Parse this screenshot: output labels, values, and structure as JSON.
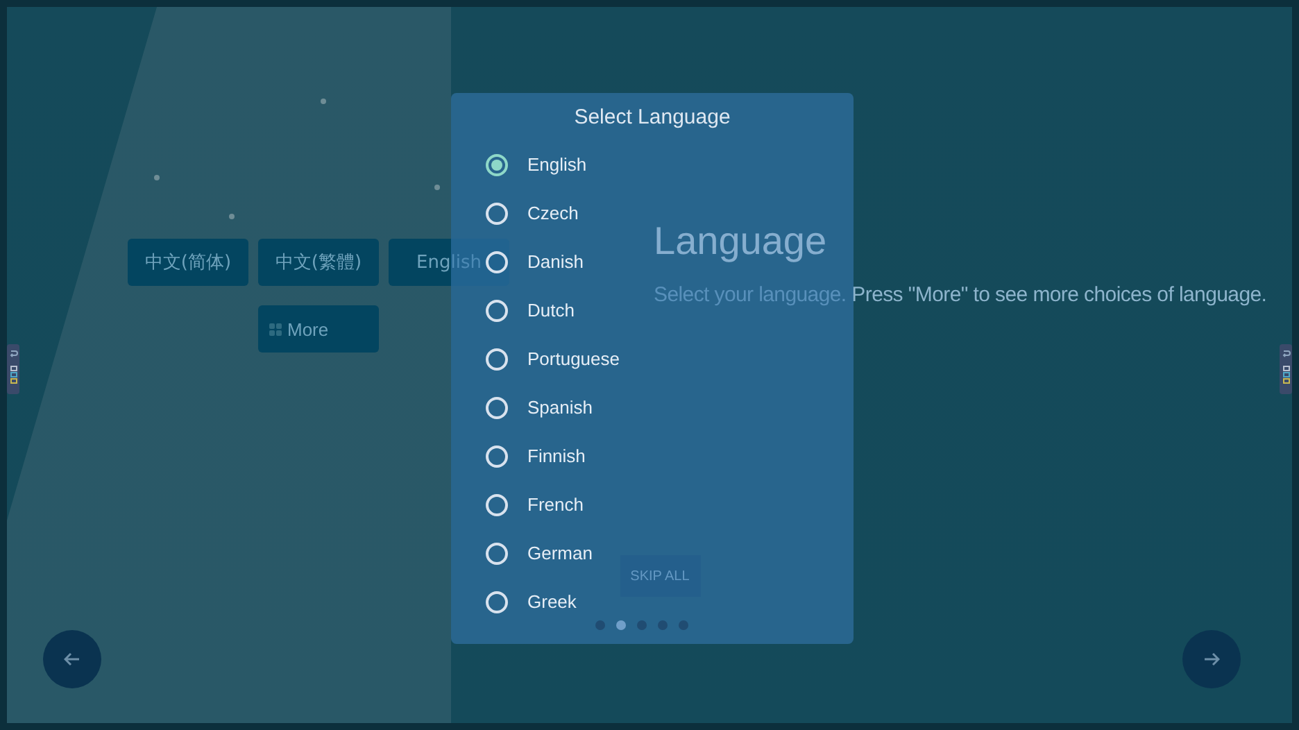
{
  "background": {
    "language_buttons": [
      {
        "label": "中文(简体)"
      },
      {
        "label": "中文(繁體)"
      },
      {
        "label": "English"
      }
    ],
    "more_button": {
      "label": "More"
    },
    "heading": "Language",
    "description": "Select your language. Press \"More\" to see more choices of language.",
    "skip_button": "SKIP ALL",
    "pages": [
      {
        "selected": false
      },
      {
        "selected": true
      },
      {
        "selected": false
      },
      {
        "selected": false
      },
      {
        "selected": false
      }
    ]
  },
  "dialog": {
    "title": "Select Language",
    "options": [
      {
        "label": "English",
        "selected": true
      },
      {
        "label": "Czech",
        "selected": false
      },
      {
        "label": "Danish",
        "selected": false
      },
      {
        "label": "Dutch",
        "selected": false
      },
      {
        "label": "Portuguese",
        "selected": false
      },
      {
        "label": "Spanish",
        "selected": false
      },
      {
        "label": "Finnish",
        "selected": false
      },
      {
        "label": "French",
        "selected": false
      },
      {
        "label": "German",
        "selected": false
      },
      {
        "label": "Greek",
        "selected": false
      }
    ]
  }
}
